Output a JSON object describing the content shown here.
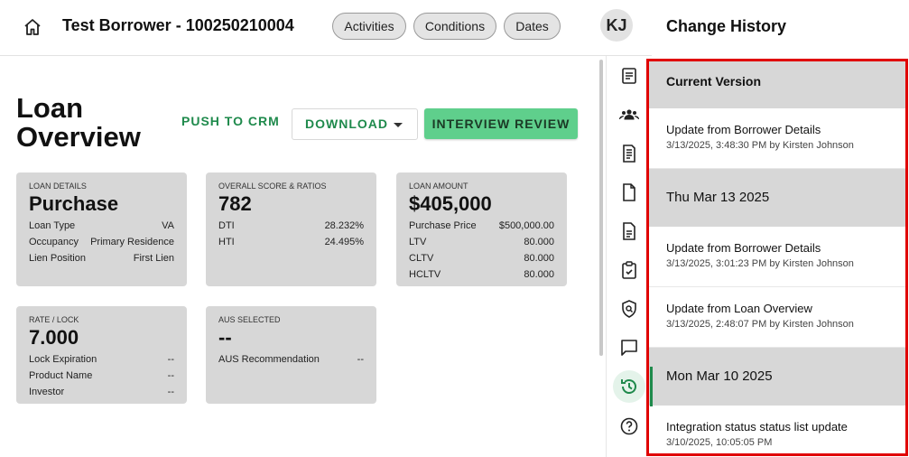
{
  "header": {
    "title": "Test Borrower - 100250210004",
    "tabs": [
      {
        "label": "Activities"
      },
      {
        "label": "Conditions"
      },
      {
        "label": "Dates"
      }
    ],
    "avatar_initials": "KJ"
  },
  "main": {
    "title": "Loan Overview",
    "push_crm_label": "PUSH TO CRM",
    "download_label": "DOWNLOAD",
    "interview_label": "INTERVIEW REVIEW",
    "cards": {
      "loan_details": {
        "caption": "LOAN DETAILS",
        "value": "Purchase",
        "rows": [
          {
            "label": "Loan Type",
            "value": "VA"
          },
          {
            "label": "Occupancy",
            "value": "Primary Residence"
          },
          {
            "label": "Lien Position",
            "value": "First Lien"
          }
        ]
      },
      "score": {
        "caption": "OVERALL SCORE & RATIOS",
        "value": "782",
        "rows": [
          {
            "label": "DTI",
            "value": "28.232%"
          },
          {
            "label": "HTI",
            "value": "24.495%"
          }
        ]
      },
      "loan_amount": {
        "caption": "LOAN AMOUNT",
        "value": "$405,000",
        "rows": [
          {
            "label": "Purchase Price",
            "value": "$500,000.00"
          },
          {
            "label": "LTV",
            "value": "80.000"
          },
          {
            "label": "CLTV",
            "value": "80.000"
          },
          {
            "label": "HCLTV",
            "value": "80.000"
          }
        ]
      },
      "rate": {
        "caption": "RATE / LOCK",
        "value": "7.000",
        "rows": [
          {
            "label": "Lock Expiration",
            "value": "--"
          },
          {
            "label": "Product Name",
            "value": "--"
          },
          {
            "label": "Investor",
            "value": "--"
          }
        ]
      },
      "aus": {
        "caption": "AUS SELECTED",
        "value": "--",
        "rows": [
          {
            "label": "AUS Recommendation",
            "value": "--"
          }
        ]
      }
    }
  },
  "history": {
    "title": "Change History",
    "current_version": "Current Version",
    "entries": [
      {
        "title": "Update from Borrower Details",
        "sub": "3/13/2025, 3:48:30 PM by Kirsten Johnson"
      },
      {
        "date": "Thu Mar 13 2025"
      },
      {
        "title": "Update from Borrower Details",
        "sub": "3/13/2025, 3:01:23 PM by Kirsten Johnson"
      },
      {
        "title": "Update from Loan Overview",
        "sub": "3/13/2025, 2:48:07 PM by Kirsten Johnson"
      },
      {
        "date": "Mon Mar 10 2025"
      },
      {
        "title": "Integration status status list update",
        "sub": "3/10/2025, 10:05:05 PM"
      }
    ]
  },
  "colors": {
    "accent": "#1f8a4c",
    "interview_bg": "#5fcf8c",
    "highlight_border": "#e00000"
  }
}
